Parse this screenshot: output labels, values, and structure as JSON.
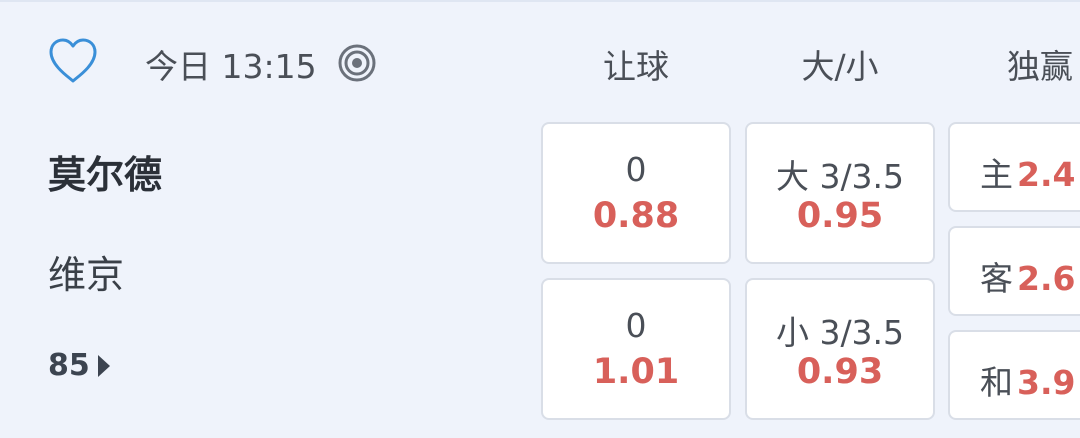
{
  "header": {
    "time": "今日 13:15",
    "columns": {
      "handicap": "让球",
      "over_under": "大/小",
      "moneyline": "独赢"
    }
  },
  "teams": {
    "home": "莫尔德",
    "away": "维京"
  },
  "more_count": "85",
  "handicap": [
    {
      "line": "0",
      "odds": "0.88"
    },
    {
      "line": "0",
      "odds": "1.01"
    }
  ],
  "over_under": [
    {
      "line": "大 3/3.5",
      "odds": "0.95"
    },
    {
      "line": "小 3/3.5",
      "odds": "0.93"
    }
  ],
  "moneyline": [
    {
      "label": "主",
      "odds": "2.4"
    },
    {
      "label": "客",
      "odds": "2.6"
    },
    {
      "label": "和",
      "odds": "3.9"
    }
  ],
  "colors": {
    "background": "#eff3fb",
    "favorite": "#3a8fd8",
    "odds": "#d8605a",
    "text": "#4a4f57"
  },
  "icons": {
    "favorite": "heart-outline-icon",
    "live": "target-icon",
    "more": "caret-right-icon"
  }
}
